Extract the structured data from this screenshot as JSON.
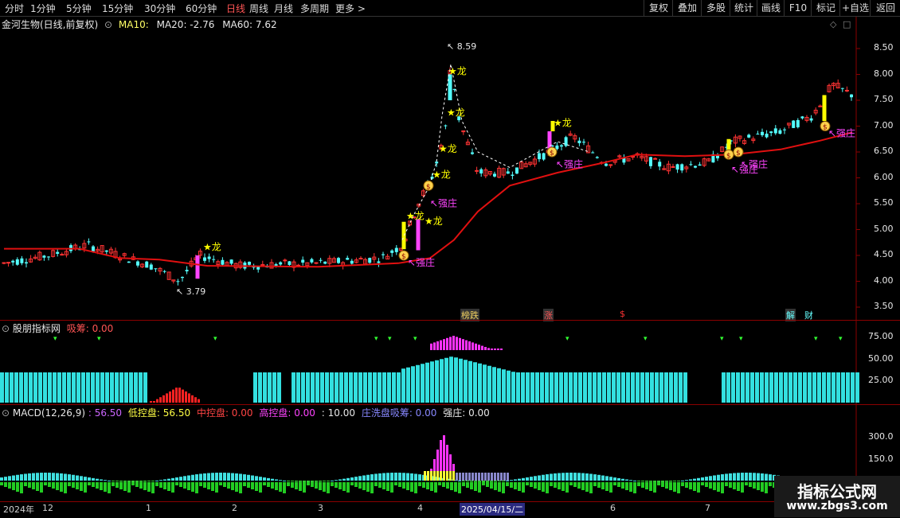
{
  "toolbar": {
    "left_items": [
      "分时",
      "1分钟",
      "5分钟",
      "15分钟",
      "30分钟",
      "60分钟",
      "日线",
      "周线",
      "月线",
      "多周期",
      "更多 >"
    ],
    "active_item": "日线",
    "right_items": [
      "复权",
      "叠加",
      "多股",
      "统计",
      "画线",
      "F10",
      "标记",
      "+自选",
      "返回"
    ]
  },
  "main": {
    "stock_name": "金河生物(日线,前复权)",
    "ma10_label": "MA10:",
    "ma20_label": "MA20: -2.76",
    "ma60_label": "MA60: 7.62",
    "high_label": "8.59",
    "low_label": "3.79",
    "y_ticks": [
      "8.50",
      "8.00",
      "7.50",
      "7.00",
      "6.50",
      "6.00",
      "5.50",
      "5.00",
      "4.50",
      "4.00",
      "3.50"
    ],
    "annotations": {
      "long": "龙",
      "qiangzhuang": "强庄",
      "bang_die": "榜跌",
      "zhang": "涨",
      "dollar": "$",
      "jie": "解",
      "cai": "财"
    },
    "colors": {
      "up": "#ff3333",
      "down": "#54ffff",
      "ma60": "#e01010",
      "long": "#ffff00",
      "qz": "#ff44ff"
    }
  },
  "panel2": {
    "title": "股朋指标网",
    "label1": "吸筹: 0.00",
    "y_ticks": [
      "75.00",
      "50.00",
      "25.00"
    ]
  },
  "panel3": {
    "title": "MACD(12,26,9)",
    "v0": ": 56.50",
    "l1": "低控盘: 56.50",
    "l2": "中控盘: 0.00",
    "l3": "高控盘: 0.00",
    "l4": ": 10.00",
    "l5": "庄洗盘吸筹: 0.00",
    "l6": "强庄: 0.00",
    "y_ticks": [
      "300.0",
      "150.0"
    ]
  },
  "xaxis": {
    "labels": [
      "2024年",
      "12",
      "1",
      "2",
      "3",
      "4",
      "2025/04/15/二",
      "6",
      "7"
    ]
  },
  "watermark": {
    "title": "指标公式网",
    "url": "www.zbgs3.com"
  }
}
